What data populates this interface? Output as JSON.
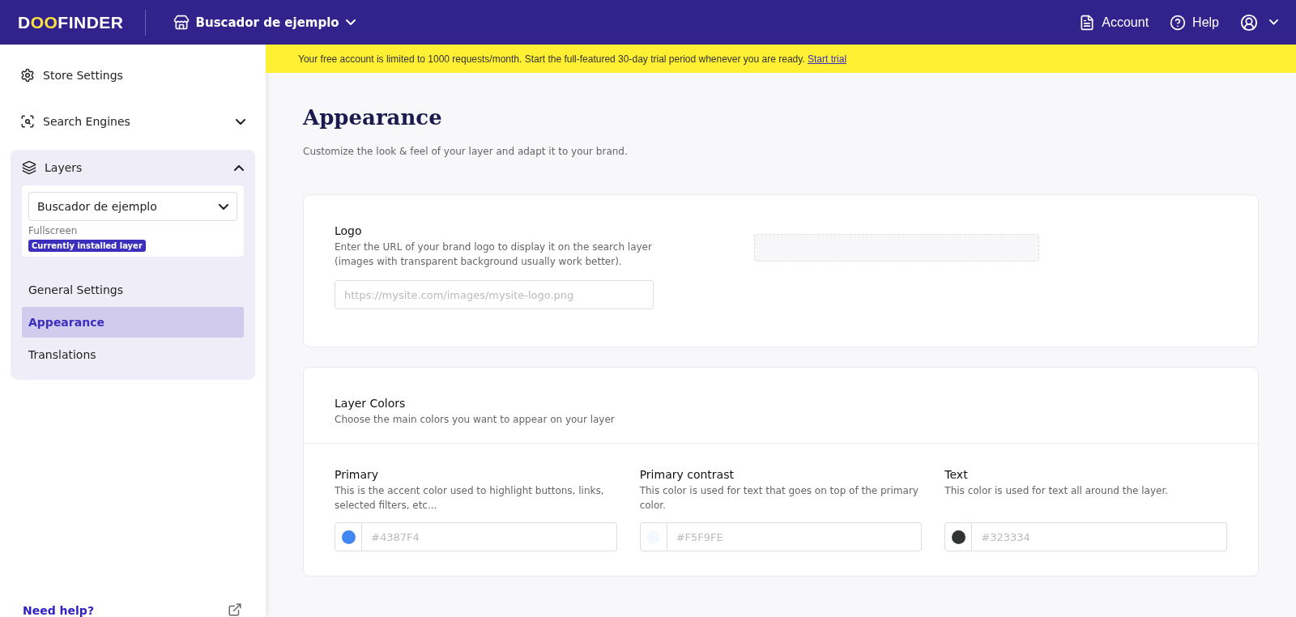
{
  "header": {
    "logo": [
      {
        "text": "D",
        "accent": false
      },
      {
        "text": "OO",
        "accent": true
      },
      {
        "text": "FINDER",
        "accent": false
      }
    ],
    "store": "Buscador de ejemplo",
    "links": [
      {
        "kind": "account",
        "label": "Account"
      },
      {
        "kind": "help",
        "label": "Help"
      }
    ]
  },
  "sidebar": {
    "items": [
      {
        "kind": "settings",
        "label": "Store Settings"
      },
      {
        "kind": "search",
        "label": "Search Engines",
        "expanded": false
      },
      {
        "kind": "layers",
        "label": "Layers",
        "expanded": true,
        "layer_select": "Buscador de ejemplo",
        "layer_type": "Fullscreen",
        "badge": "Currently installed layer",
        "children": [
          {
            "label": "General Settings",
            "selected": false
          },
          {
            "label": "Appearance",
            "selected": true
          },
          {
            "label": "Translations",
            "selected": false
          }
        ]
      }
    ],
    "help_link": "Need help?"
  },
  "banner": {
    "text": "Your free account is limited to 1000 requests/month. Start the full-featured 30-day trial period whenever you are ready.",
    "link": "Start trial"
  },
  "page": {
    "title": "Appearance",
    "subtitle": "Customize the look & feel of your layer and adapt it to your brand."
  },
  "logo_card": {
    "title": "Logo",
    "description": "Enter the URL of your brand logo to display it on the search layer (images with transparent background usually work better).",
    "placeholder": "https://mysite.com/images/mysite-logo.png"
  },
  "colors_card": {
    "title": "Layer Colors",
    "description": "Choose the main colors you want to appear on your layer",
    "fields": [
      {
        "label": "Primary",
        "description": "This is the accent color used to highlight buttons, links, selected filters, etc...",
        "placeholder": "#4387F4",
        "color": "#4387f4"
      },
      {
        "label": "Primary contrast",
        "description": "This color is used for text that goes on top of the primary color.",
        "placeholder": "#F5F9FE",
        "color": "#f5f9fe"
      },
      {
        "label": "Text",
        "description": "This color is used for text all around the layer.",
        "placeholder": "#323334",
        "color": "#323334"
      }
    ]
  }
}
